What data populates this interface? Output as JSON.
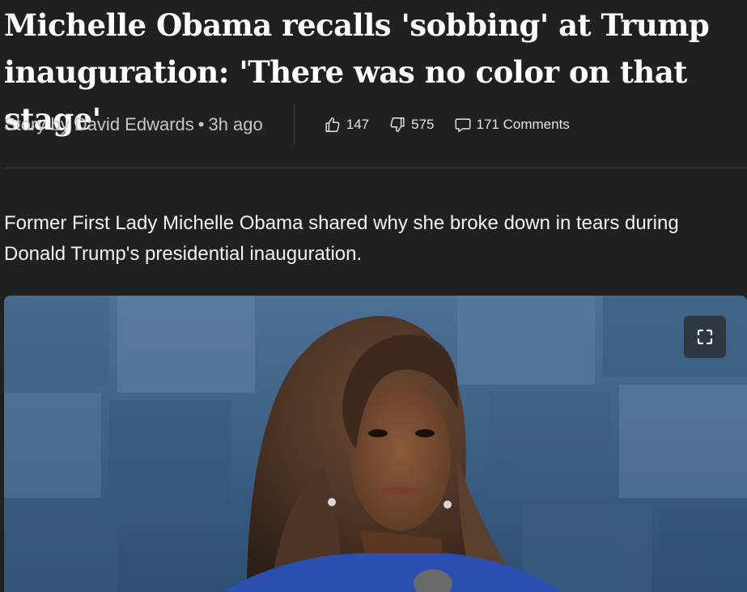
{
  "article": {
    "title": "Michelle Obama recalls 'sobbing' at Trump inauguration: 'There was no color on that stage'",
    "byline": {
      "author_text": "Story by David Edwards",
      "separator": "•",
      "time_ago": "3h ago"
    },
    "reactions": {
      "likes": {
        "icon": "thumbs-up-icon",
        "count": "147"
      },
      "dislikes": {
        "icon": "thumbs-down-icon",
        "count": "575"
      },
      "comments": {
        "icon": "comment-icon",
        "label": "171 Comments"
      }
    },
    "lede": "Former First Lady Michelle Obama shared why she broke down in tears during Donald Trump's presidential inauguration.",
    "hero_image": {
      "controls": {
        "fullscreen_icon": "expand-icon"
      }
    }
  },
  "theme": {
    "background": "#202020",
    "text": "#ffffff",
    "muted_text": "#c7c7c7",
    "divider": "#3a3a3a"
  }
}
